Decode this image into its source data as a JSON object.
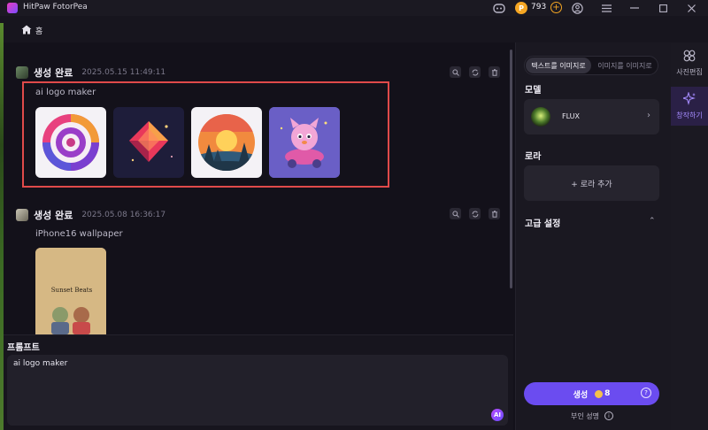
{
  "titlebar": {
    "app_name": "HitPaw FotorPea",
    "credits": "793"
  },
  "breadcrumb": {
    "label": "홈"
  },
  "feed": {
    "groups": [
      {
        "status": "생성 완료",
        "time": "2025.05.15  11:49:11",
        "prompt": "ai logo maker"
      },
      {
        "status": "생성 완료",
        "time": "2025.05.08  16:36:17",
        "prompt": "iPhone16 wallpaper"
      }
    ],
    "wallpaper_caption": "Sunset Beats"
  },
  "prompt": {
    "heading": "프롬프트",
    "value": "ai logo maker",
    "ai_badge": "AI"
  },
  "settings": {
    "tab_active": "텍스트를 이미지로",
    "tab_inactive": "이미지를 이미지로",
    "model_label": "모델",
    "model_name": "FLUX",
    "lora_label": "로라",
    "lora_add": "+ 로라 추가",
    "advanced_label": "고급 설정",
    "generate_label": "생성",
    "generate_cost": "8",
    "negative_link": "부인 성명"
  },
  "rightnav": {
    "item1": "사진편집",
    "item2": "창작하기"
  },
  "colors": {
    "accent": "#6b4cf0",
    "highlight": "#e04a4a",
    "coin": "#f5a623"
  }
}
